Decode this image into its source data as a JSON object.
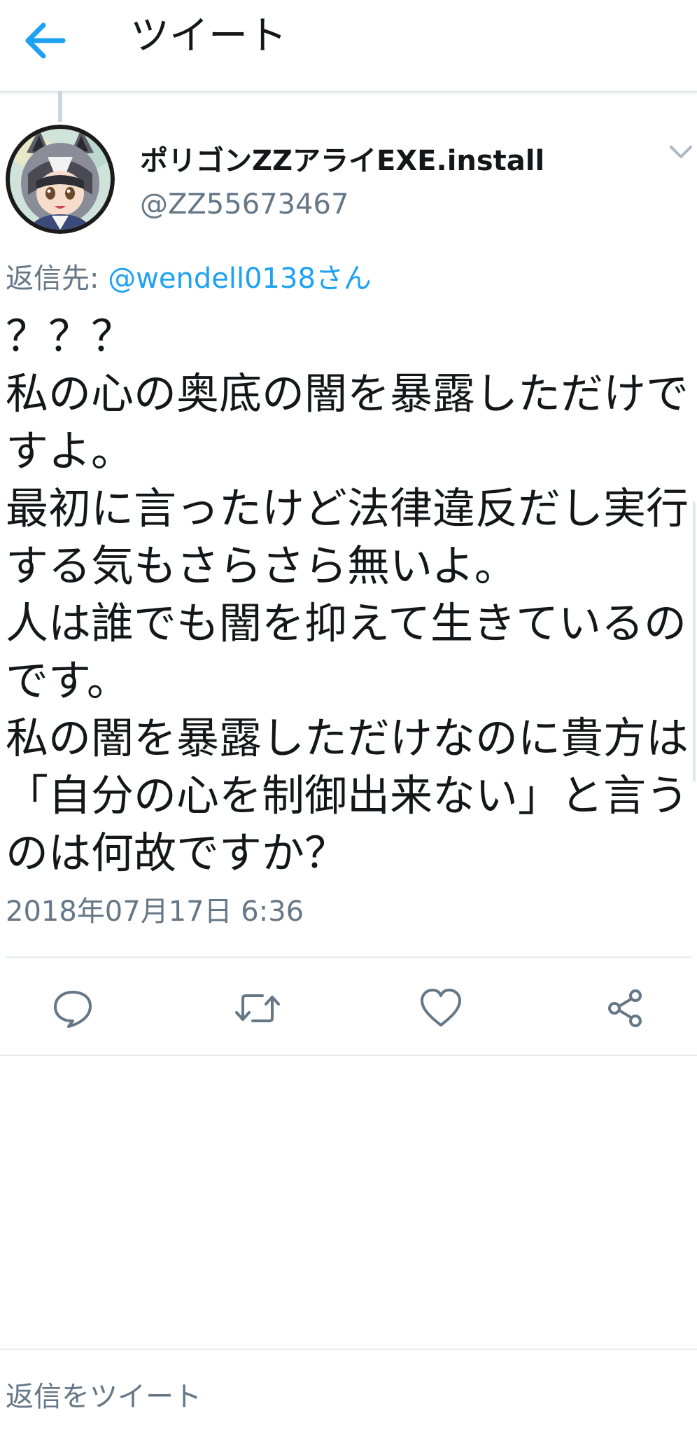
{
  "header": {
    "title": "ツイート",
    "back_icon": "arrow-left-icon"
  },
  "accent_color": "#1da1f2",
  "tweet": {
    "author": {
      "display_name": "ポリゴンZZアライEXE.install",
      "handle": "@ZZ55673467"
    },
    "reply_to": {
      "label": "返信先:",
      "mention": "@wendell0138さん"
    },
    "text_lines": [
      "？？？",
      "私の心の奥底の闇を暴露しただけで",
      "すよ。",
      "最初に言ったけど法律違反だし実行",
      "する気もさらさら無いよ。",
      "人は誰でも闇を抑えて生きているの",
      "です。",
      "私の闇を暴露しただけなのに貴方は",
      "「自分の心を制御出来ない」と言う",
      "のは何故ですか？"
    ],
    "timestamp": "2018年07月17日 6:36"
  },
  "actions": {
    "reply_icon": "comment-icon",
    "retweet_icon": "retweet-icon",
    "like_icon": "heart-icon",
    "share_icon": "share-icon"
  },
  "reply_bar": {
    "placeholder": "返信をツイート"
  }
}
